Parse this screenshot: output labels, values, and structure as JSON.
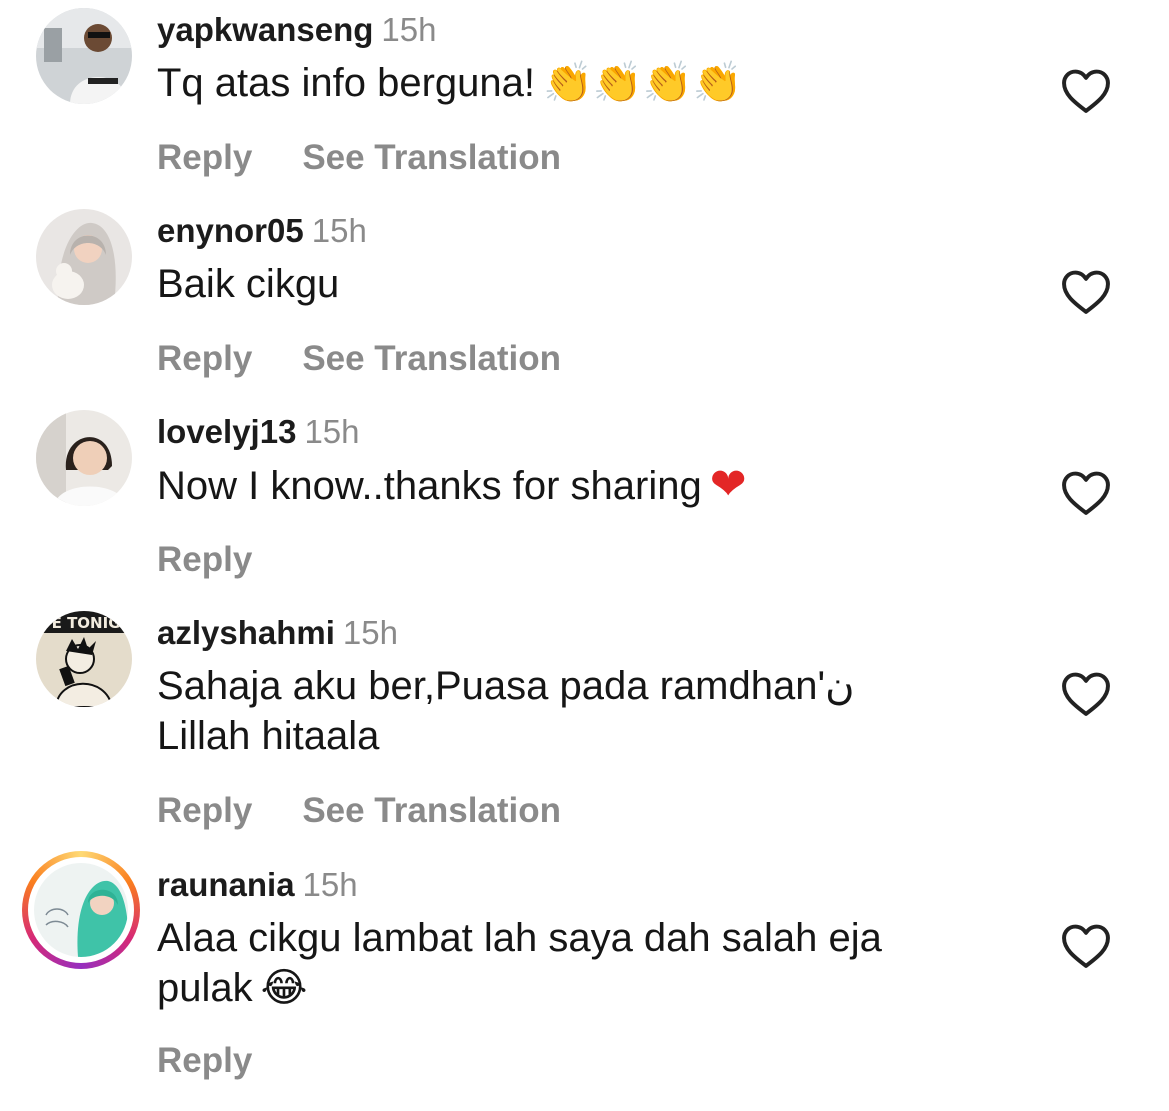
{
  "comments": [
    {
      "username": "yapkwanseng",
      "time": "15h",
      "text": "Tq atas info berguna!",
      "emoji": "👏👏👏👏",
      "reply_label": "Reply",
      "translation_label": "See Translation"
    },
    {
      "username": "enynor05",
      "time": "15h",
      "text": "Baik cikgu",
      "reply_label": "Reply",
      "translation_label": "See Translation"
    },
    {
      "username": "lovelyj13",
      "time": "15h",
      "text": "Now I know..thanks for sharing",
      "emoji": "❤",
      "reply_label": "Reply"
    },
    {
      "username": "azlyshahmi",
      "time": "15h",
      "text": "Sahaja aku ber,Puasa pada ramdhan'ن Lillah hitaala",
      "reply_label": "Reply",
      "translation_label": "See Translation",
      "avatar_text": "VE TONIGH"
    },
    {
      "username": "raunania",
      "time": "15h",
      "text": "Alaa cikgu lambat lah saya dah salah eja pulak",
      "emoji": "😂",
      "reply_label": "Reply"
    }
  ],
  "icons": {
    "like": "heart-outline-icon"
  },
  "colors": {
    "secondary_text": "#8a8a8a",
    "primary_text": "#161616",
    "story_ring": "#d62976"
  }
}
